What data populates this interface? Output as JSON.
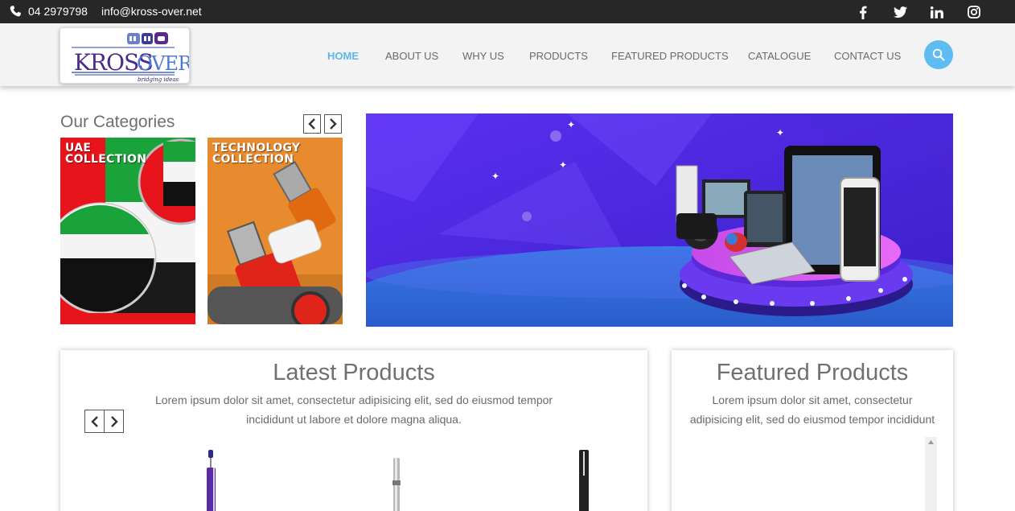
{
  "topbar": {
    "phone": "04 2979798",
    "email": "info@kross-over.net",
    "social": [
      {
        "icon": "facebook-icon",
        "glyph": "f"
      },
      {
        "icon": "twitter-icon",
        "glyph": "t"
      },
      {
        "icon": "linkedin-icon",
        "glyph": "in"
      },
      {
        "icon": "instagram-icon",
        "glyph": "ig"
      }
    ]
  },
  "header": {
    "logo_text": "KROSS OVER",
    "logo_tagline": "bridging ideas",
    "nav": [
      "HOME",
      "ABOUT US",
      "WHY US",
      "PRODUCTS",
      "FEATURED PRODUCTS",
      "CATALOGUE",
      "CONTACT US"
    ],
    "active_nav": "HOME"
  },
  "categories": {
    "title": "Our Categories",
    "tiles": [
      {
        "label": "UAE\nCOLLECTION"
      },
      {
        "label": "TECHNOLOGY\nCOLLECTION"
      }
    ]
  },
  "latest": {
    "title": "Latest Products",
    "text": "Lorem ipsum dolor sit amet, consectetur adipisicing elit, sed do eiusmod tempor incididunt ut labore et dolore magna aliqua."
  },
  "featured": {
    "title": "Featured Products",
    "text": "Lorem ipsum dolor sit amet, consectetur adipisicing elit, sed do eiusmod tempor incididunt"
  },
  "colors": {
    "accent": "#5fbcf0",
    "topbar": "#272727",
    "header": "#f4f3f3"
  }
}
